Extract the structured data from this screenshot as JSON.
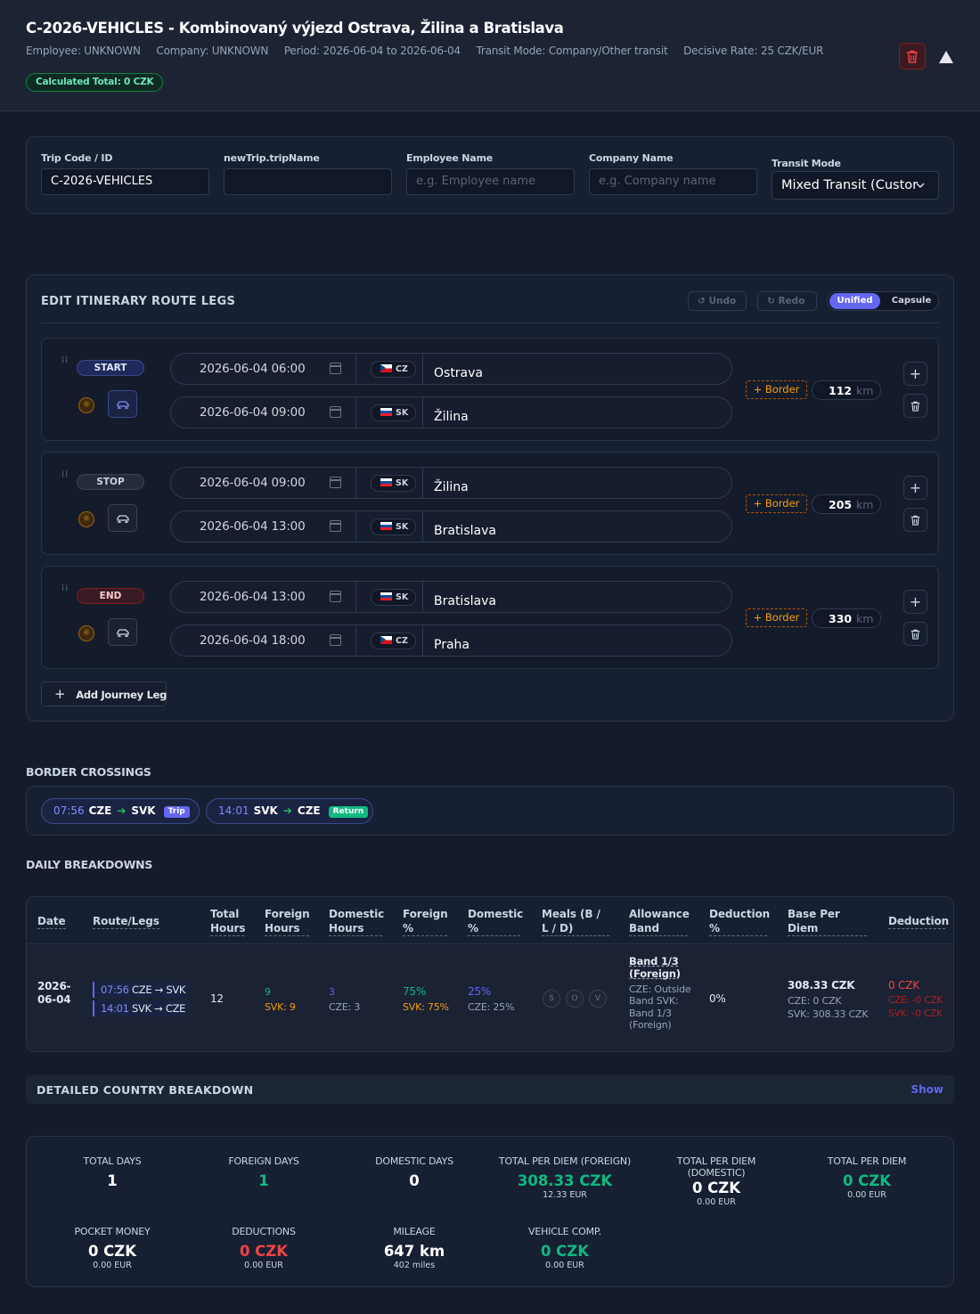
{
  "header": {
    "title": "C-2026-VEHICLES - Kombinovaný výjezd Ostrava, Žilina a Bratislava",
    "employee": "Employee: UNKNOWN",
    "company": "Company: UNKNOWN",
    "period": "Period: 2026-06-04 to 2026-06-04",
    "transit": "Transit Mode: Company/Other transit",
    "rate": "Decisive Rate: 25 CZK/EUR",
    "total": "Calculated Total: 0 CZK"
  },
  "form": {
    "trip_code_label": "Trip Code / ID",
    "trip_code_value": "C-2026-VEHICLES",
    "trip_name_label": "newTrip.tripName",
    "trip_name_value": "",
    "employee_label": "Employee Name",
    "employee_placeholder": "e.g. Employee name",
    "company_label": "Company Name",
    "company_placeholder": "e.g. Company name",
    "transit_label": "Transit Mode",
    "transit_value": "Mixed Transit (Custor"
  },
  "itinerary": {
    "title": "EDIT ITINERARY ROUTE LEGS",
    "undo": "Undo",
    "redo": "Redo",
    "view_unified": "Unified",
    "view_capsule": "Capsule",
    "add_leg": "Add Journey Leg",
    "border_label": "+ Border",
    "km_unit": "km",
    "legs": [
      {
        "badge": "START",
        "from_dt": "2026-06-04 06:00",
        "from_cc": "CZ",
        "from_city": "Ostrava",
        "to_dt": "2026-06-04 09:00",
        "to_cc": "SK",
        "to_city": "Žilina",
        "km": "112"
      },
      {
        "badge": "STOP",
        "from_dt": "2026-06-04 09:00",
        "from_cc": "SK",
        "from_city": "Žilina",
        "to_dt": "2026-06-04 13:00",
        "to_cc": "SK",
        "to_city": "Bratislava",
        "km": "205"
      },
      {
        "badge": "END",
        "from_dt": "2026-06-04 13:00",
        "from_cc": "SK",
        "from_city": "Bratislava",
        "to_dt": "2026-06-04 18:00",
        "to_cc": "CZ",
        "to_city": "Praha",
        "km": "330"
      }
    ]
  },
  "borders": {
    "title": "BORDER CROSSINGS",
    "items": [
      {
        "time": "07:56",
        "from": "CZE",
        "to": "SVK",
        "tag": "Trip",
        "tag_color": "#6366f1"
      },
      {
        "time": "14:01",
        "from": "SVK",
        "to": "CZE",
        "tag": "Return",
        "tag_color": "#10b981"
      }
    ]
  },
  "daily": {
    "title": "DAILY BREAKDOWNS",
    "columns": [
      "Date",
      "Route/Legs",
      "Total Hours",
      "Foreign Hours",
      "Domestic Hours",
      "Foreign %",
      "Domestic %",
      "Meals (B / L / D)",
      "Allowance Band",
      "Deduction %",
      "Base Per Diem",
      "Deduction"
    ],
    "row": {
      "date": "2026-06-04",
      "route1_time": "07:56",
      "route1": "CZE → SVK",
      "route2_time": "14:01",
      "route2": "SVK → CZE",
      "total_hours": "12",
      "foreign_hours": "9",
      "foreign_hours_sub": "SVK: 9",
      "domestic_hours": "3",
      "domestic_hours_sub": "CZE: 3",
      "foreign_pct": "75%",
      "foreign_pct_sub": "SVK: 75%",
      "domestic_pct": "25%",
      "domestic_pct_sub": "CZE: 25%",
      "meals": [
        "S",
        "O",
        "V"
      ],
      "band": "Band 1/3 (Foreign)",
      "band_detail": "CZE: Outside Band SVK: Band 1/3 (Foreign)",
      "deduction_pct": "0%",
      "base": "308.33 CZK",
      "base_cze": "CZE: 0 CZK",
      "base_svk": "SVK: 308.33 CZK",
      "deduction": "0 CZK",
      "deduction_cze": "CZE: -0 CZK",
      "deduction_svk": "SVK: -0 CZK"
    }
  },
  "detail": {
    "title": "DETAILED COUNTRY BREAKDOWN",
    "show": "Show"
  },
  "summary": {
    "total_days_label": "TOTAL DAYS",
    "total_days": "1",
    "foreign_days_label": "FOREIGN DAYS",
    "foreign_days": "1",
    "domestic_days_label": "DOMESTIC DAYS",
    "domestic_days": "0",
    "pd_foreign_label": "TOTAL PER DIEM (FOREIGN)",
    "pd_foreign": "308.33 CZK",
    "pd_foreign_eur": "12.33 EUR",
    "pd_domestic_label": "TOTAL PER DIEM (DOMESTIC)",
    "pd_domestic": "0 CZK",
    "pd_domestic_eur": "0.00 EUR",
    "pd_total_label": "TOTAL PER DIEM",
    "pd_total": "0 CZK",
    "pd_total_eur": "0.00 EUR",
    "pocket_label": "POCKET MONEY",
    "pocket": "0 CZK",
    "pocket_eur": "0.00 EUR",
    "deductions_label": "DEDUCTIONS",
    "deductions": "0 CZK",
    "deductions_eur": "0.00 EUR",
    "mileage_label": "MILEAGE",
    "mileage": "647 km",
    "mileage_miles": "402 miles",
    "vehicle_label": "VEHICLE COMP.",
    "vehicle": "0 CZK",
    "vehicle_eur": "0.00 EUR"
  }
}
